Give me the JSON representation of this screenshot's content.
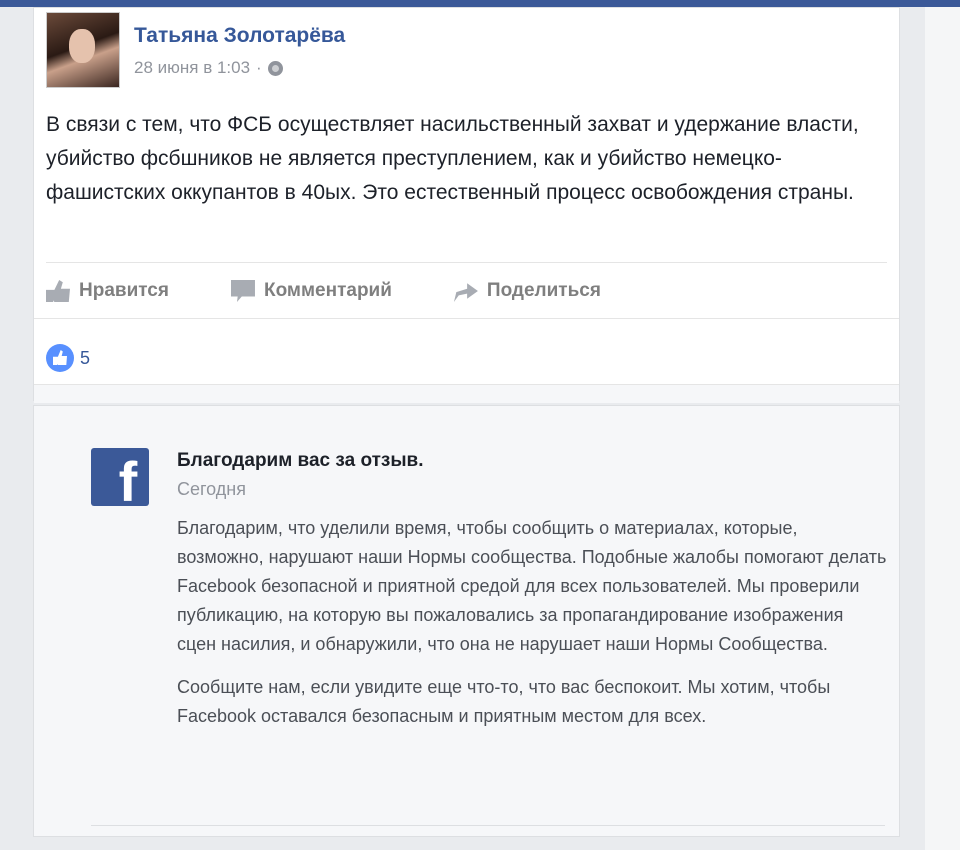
{
  "post": {
    "author": "Татьяна Золотарёва",
    "date": "28 июня в 1:03",
    "separator": "·",
    "text": "В связи с тем, что ФСБ осуществляет насильственный захват и удержание власти, убийство фсбшников не является преступлением, как и убийство немецко-фашистских оккупантов в 40ых. Это естественный процесс освобождения страны.",
    "actions": {
      "like": "Нравится",
      "comment": "Комментарий",
      "share": "Поделиться"
    },
    "like_count": "5"
  },
  "notice": {
    "title": "Благодарим вас за отзыв.",
    "date": "Сегодня",
    "paragraph1": "Благодарим, что уделили время, чтобы сообщить о материалах, которые, возможно, нарушают наши Нормы сообщества. Подобные жалобы помогают делать Facebook безопасной и приятной средой для всех пользователей. Мы проверили публикацию, на которую вы пожаловались за пропагандирование изображения сцен насилия, и обнаружили, что она не нарушает наши Нормы Сообщества.",
    "paragraph2": "Сообщите нам, если увидите еще что-то, что вас беспокоит. Мы хотим, чтобы Facebook оставался безопасным и приятным местом для всех.",
    "logo_letter": "f"
  },
  "icons": {
    "like": "thumbs-up-icon",
    "comment": "comment-icon",
    "share": "share-arrow-icon",
    "privacy": "globe-icon",
    "reaction": "like-reaction-icon",
    "brand": "facebook-logo-icon"
  },
  "colors": {
    "brand": "#3b5998",
    "link": "#365899",
    "reaction": "#5890ff",
    "muted": "#90949c"
  }
}
